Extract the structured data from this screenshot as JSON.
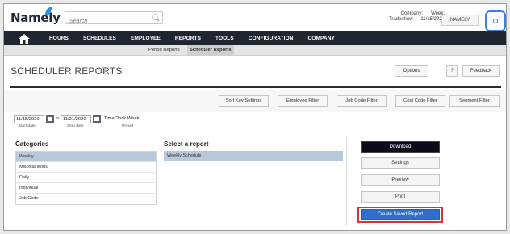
{
  "app": {
    "logo_text": "Namely"
  },
  "search": {
    "placeholder": "Search"
  },
  "company": {
    "company_label": "Company:",
    "company_value": "Tradeshow",
    "week_label": "Week:",
    "week_value": "11/15/2020",
    "switch_label": "NAMELY"
  },
  "nav": {
    "items": [
      {
        "label": "HOURS"
      },
      {
        "label": "SCHEDULES"
      },
      {
        "label": "EMPLOYEE"
      },
      {
        "label": "REPORTS"
      },
      {
        "label": "TOOLS"
      },
      {
        "label": "CONFIGURATION"
      },
      {
        "label": "COMPANY"
      }
    ],
    "active": "REPORTS"
  },
  "subnav": {
    "items": [
      {
        "label": "Period Reports"
      },
      {
        "label": "Scheduler Reports"
      }
    ]
  },
  "header": {
    "title": "SCHEDULER REPORTS",
    "options_label": "Options",
    "help_label": "?",
    "feedback_label": "Feedback"
  },
  "filters": [
    {
      "label": "Sort Key Settings"
    },
    {
      "label": "Employee Filter"
    },
    {
      "label": "Job Code Filter"
    },
    {
      "label": "Cost Code Filter"
    },
    {
      "label": "Segment Filter"
    }
  ],
  "dates": {
    "start_value": "11/15/2020",
    "start_caption": "Start date",
    "to_label": "to",
    "stop_value": "11/21/2020",
    "stop_caption": "Stop date",
    "period_value": "TimeClock Week",
    "period_caption": "Period"
  },
  "categories": {
    "title": "Categories",
    "items": [
      "Weekly",
      "Miscellaneous",
      "Daily",
      "Individual",
      "Job Code"
    ],
    "selected": "Weekly"
  },
  "reports": {
    "title": "Select a report",
    "items": [
      "Weekly Schedule"
    ]
  },
  "actions": {
    "download_label": "Download",
    "settings_label": "Settings",
    "preview_label": "Preview",
    "print_label": "Print",
    "create_saved_label": "Create Saved Report"
  },
  "colors": {
    "nav_bg": "#1f2630",
    "selected_row": "#b8c9dc",
    "primary_button": "#2e6fcd",
    "highlight_border": "#e03030"
  }
}
